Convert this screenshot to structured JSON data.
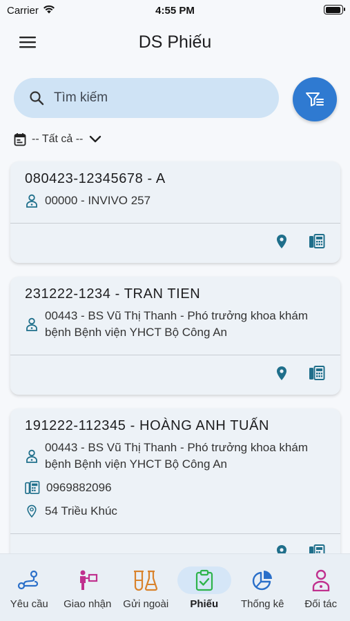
{
  "status_bar": {
    "carrier": "Carrier",
    "time": "4:55 PM"
  },
  "header": {
    "title": "DS Phiếu"
  },
  "search": {
    "placeholder": "Tìm kiếm"
  },
  "date_filter": {
    "label": "-- Tất cả --"
  },
  "tickets": [
    {
      "title": "080423-12345678 - A",
      "doctor": "00000 - INVIVO 257",
      "phone": "",
      "address": ""
    },
    {
      "title": "231222-1234 - TRAN TIEN",
      "doctor": "00443 - BS Vũ Thị Thanh - Phó trưởng khoa khám bệnh Bệnh viện YHCT Bộ Công An",
      "phone": "",
      "address": ""
    },
    {
      "title": "191222-112345 - HOÀNG ANH TUẤN",
      "doctor": "00443 - BS Vũ Thị Thanh - Phó trưởng khoa khám bệnh Bệnh viện YHCT Bộ Công An",
      "phone": "0969882096",
      "address": "54 Triều Khúc"
    }
  ],
  "bottom_nav": {
    "items": [
      {
        "label": "Yêu cầu"
      },
      {
        "label": "Giao nhận"
      },
      {
        "label": "Gửi ngoài"
      },
      {
        "label": "Phiếu"
      },
      {
        "label": "Thống kê"
      },
      {
        "label": "Đối tác"
      }
    ]
  },
  "colors": {
    "accent": "#2f7ad1",
    "icon_teal": "#1f6f8b",
    "nav_active": "#2db34a",
    "nav_blue": "#2a6fc9",
    "nav_magenta": "#c0308e",
    "nav_orange": "#d9822b"
  }
}
